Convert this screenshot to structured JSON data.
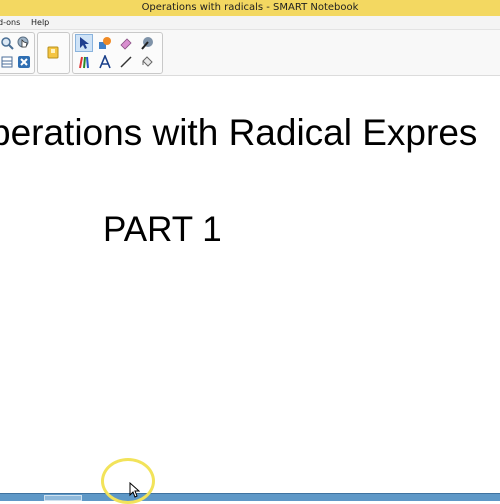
{
  "window": {
    "title": "Operations with radicals - SMART Notebook"
  },
  "menubar": {
    "items": [
      {
        "label": "d-ons"
      },
      {
        "label": "Help"
      }
    ]
  },
  "toolbar": {
    "icons": [
      "magnifier-icon",
      "hand-pointer-icon",
      "table-icon",
      "delete-icon",
      "attachment-icon",
      "select-arrow-icon",
      "shapes-icon",
      "eraser-icon",
      "magic-pen-icon",
      "pens-icon",
      "text-icon",
      "line-icon",
      "fill-icon"
    ]
  },
  "page": {
    "heading": "perations with Radical Expres",
    "subheading": "PART 1"
  },
  "colors": {
    "titlebar": "#f3d861",
    "taskbar": "#5e98c7",
    "cursor_highlight": "#f2e35a"
  }
}
